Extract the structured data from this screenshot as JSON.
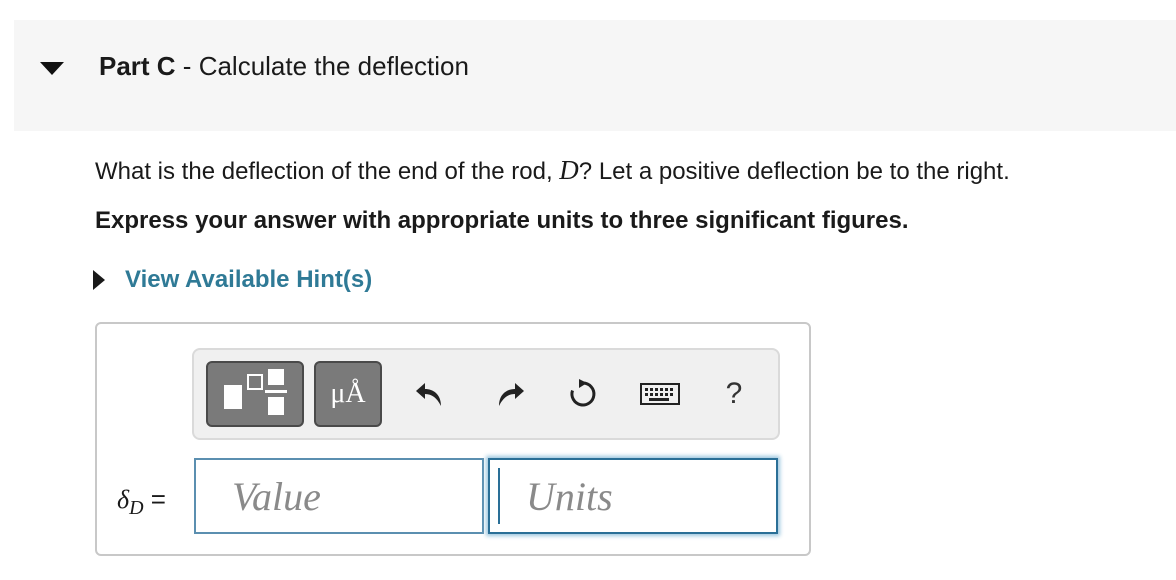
{
  "part": {
    "label": "Part C",
    "separator": " - ",
    "title": "Calculate the deflection"
  },
  "question": {
    "text_before": "What is the deflection of the end of the rod, ",
    "variable": "D",
    "text_after": "? Let a positive deflection be to the right."
  },
  "instruction": "Express your answer with appropriate units to three significant figures.",
  "hint_link": "View Available Hint(s)",
  "toolbar": {
    "units_button": "μÅ",
    "help": "?"
  },
  "answer": {
    "symbol": "δ",
    "subscript": "D",
    "equals": "=",
    "value_placeholder": "Value",
    "units_placeholder": "Units"
  },
  "colors": {
    "link": "#2f7a96",
    "header_bg": "#f6f6f6",
    "input_focus": "#2a6f97"
  }
}
